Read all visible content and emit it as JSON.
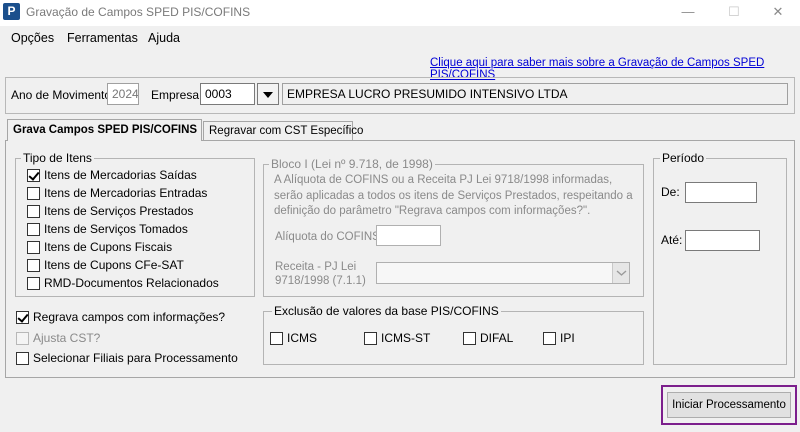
{
  "window": {
    "title": "Gravação de Campos SPED PIS/COFINS",
    "app_icon_letter": "P",
    "minimize": "—",
    "maximize": "☐",
    "close": "✕"
  },
  "menu": [
    "Opções",
    "Ferramentas",
    "Ajuda"
  ],
  "help_link": "Clique aqui para saber mais sobre a Gravação de Campos SPED PIS/COFINS",
  "header": {
    "ano_label": "Ano de Movimento:",
    "ano_value": "2024",
    "empresa_label": "Empresa:",
    "empresa_code": "0003",
    "empresa_name": "EMPRESA LUCRO PRESUMIDO INTENSIVO LTDA"
  },
  "tabs": [
    {
      "label": "Grava Campos SPED PIS/COFINS",
      "active": true
    },
    {
      "label": "Regravar com CST Específico",
      "active": false
    }
  ],
  "tipo_itens": {
    "legend": "Tipo de Itens",
    "items": [
      {
        "label": "Itens de Mercadorias Saídas",
        "checked": true
      },
      {
        "label": "Itens de Mercadorias Entradas",
        "checked": false
      },
      {
        "label": "Itens de Serviços Prestados",
        "checked": false
      },
      {
        "label": "Itens de Serviços Tomados",
        "checked": false
      },
      {
        "label": "Itens de Cupons Fiscais",
        "checked": false
      },
      {
        "label": "Itens de Cupons CFe-SAT",
        "checked": false
      },
      {
        "label": "RMD-Documentos Relacionados",
        "checked": false
      }
    ]
  },
  "options": [
    {
      "label": "Regrava campos com informações?",
      "checked": true,
      "disabled": false
    },
    {
      "label": "Ajusta CST?",
      "checked": false,
      "disabled": true
    },
    {
      "label": "Selecionar Filiais para Processamento",
      "checked": false,
      "disabled": false
    }
  ],
  "bloco": {
    "legend": "Bloco I (Lei nº 9.718, de 1998)",
    "description": "A Alíquota de COFINS ou a Receita PJ Lei 9718/1998 informadas, serão aplicadas a todos os itens de Serviços Prestados, respeitando a definição do parâmetro \"Regrava campos com informações?\".",
    "aliquota_label": "Alíquota do COFINS",
    "aliquota_value": "",
    "receita_label_line1": "Receita - PJ Lei",
    "receita_label_line2": "9718/1998 (7.1.1)",
    "receita_value": ""
  },
  "exclusao": {
    "legend": "Exclusão de valores da base PIS/COFINS",
    "items": [
      {
        "label": "ICMS",
        "checked": false
      },
      {
        "label": "ICMS-ST",
        "checked": false
      },
      {
        "label": "DIFAL",
        "checked": false
      },
      {
        "label": "IPI",
        "checked": false
      }
    ]
  },
  "periodo": {
    "legend": "Período",
    "de_label": "De:",
    "de_value": "",
    "ate_label": "Até:",
    "ate_value": ""
  },
  "start_button": "Iniciar Processamento"
}
